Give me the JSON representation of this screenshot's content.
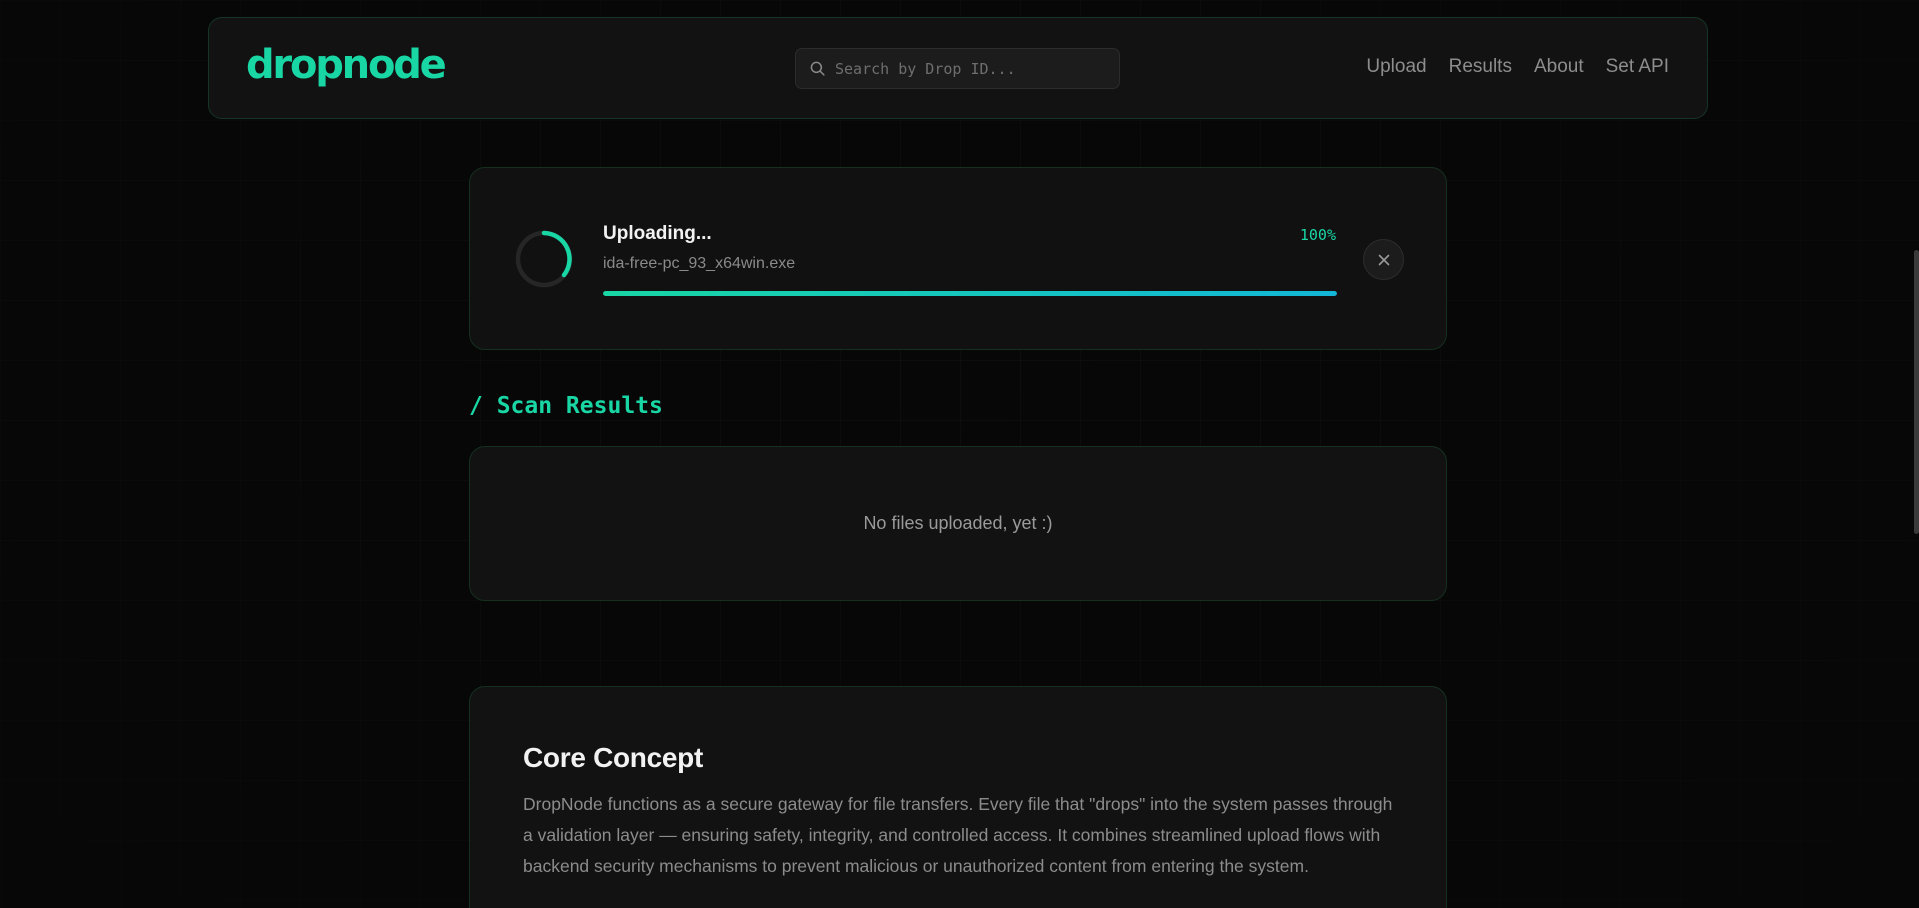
{
  "header": {
    "logo": "dropnode",
    "search_placeholder": "Search by Drop ID...",
    "nav": [
      {
        "label": "Upload"
      },
      {
        "label": "Results"
      },
      {
        "label": "About"
      },
      {
        "label": "Set API"
      }
    ]
  },
  "upload": {
    "status": "Uploading...",
    "filename": "ida-free-pc_93_x64win.exe",
    "percent_label": "100%",
    "progress": 1.0
  },
  "results": {
    "heading": "/ Scan Results",
    "empty_message": "No files uploaded, yet :)"
  },
  "concept": {
    "title": "Core Concept",
    "body": "DropNode functions as a secure gateway for file transfers. Every file that \"drops\" into the system passes through a validation layer — ensuring safety, integrity, and controlled access. It combines streamlined upload flows with backend security mechanisms to prevent malicious or unauthorized content from entering the system."
  },
  "colors": {
    "accent": "#19d6a5",
    "accent_secondary": "#13b6d6",
    "background": "#070707",
    "card": "#121212"
  }
}
